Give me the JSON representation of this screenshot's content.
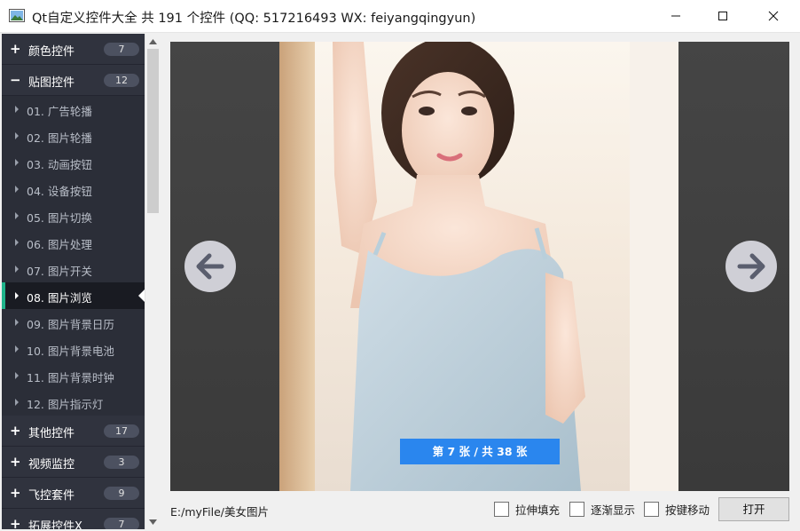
{
  "window": {
    "title": "Qt自定义控件大全 共 191 个控件 (QQ: 517216493 WX: feiyangqingyun)",
    "icon": "app-image-icon"
  },
  "sidebar": {
    "groups_top": [
      {
        "sign": "+",
        "label": "颜色控件",
        "count": "7"
      },
      {
        "sign": "−",
        "label": "贴图控件",
        "count": "12"
      }
    ],
    "children": [
      {
        "label": "01. 广告轮播"
      },
      {
        "label": "02. 图片轮播"
      },
      {
        "label": "03. 动画按钮"
      },
      {
        "label": "04. 设备按钮"
      },
      {
        "label": "05. 图片切换"
      },
      {
        "label": "06. 图片处理"
      },
      {
        "label": "07. 图片开关"
      },
      {
        "label": "08. 图片浏览"
      },
      {
        "label": "09. 图片背景日历"
      },
      {
        "label": "10. 图片背景电池"
      },
      {
        "label": "11. 图片背景时钟"
      },
      {
        "label": "12. 图片指示灯"
      }
    ],
    "active_index": 7,
    "groups_bottom": [
      {
        "sign": "+",
        "label": "其他控件",
        "count": "17"
      },
      {
        "sign": "+",
        "label": "视频监控",
        "count": "3"
      },
      {
        "sign": "+",
        "label": "飞控套件",
        "count": "9"
      },
      {
        "sign": "+",
        "label": "拓展控件X",
        "count": "7"
      }
    ],
    "accent_color": "#1fb38a"
  },
  "viewer": {
    "pager_text": "第 7 张 / 共 38 张",
    "pager_color": "#2a86ee",
    "prev_icon": "arrow-left-icon",
    "next_icon": "arrow-right-icon"
  },
  "footer": {
    "path": "E:/myFile/美女图片",
    "checkboxes": [
      "拉伸填充",
      "逐渐显示",
      "按键移动"
    ],
    "open_label": "打开"
  }
}
